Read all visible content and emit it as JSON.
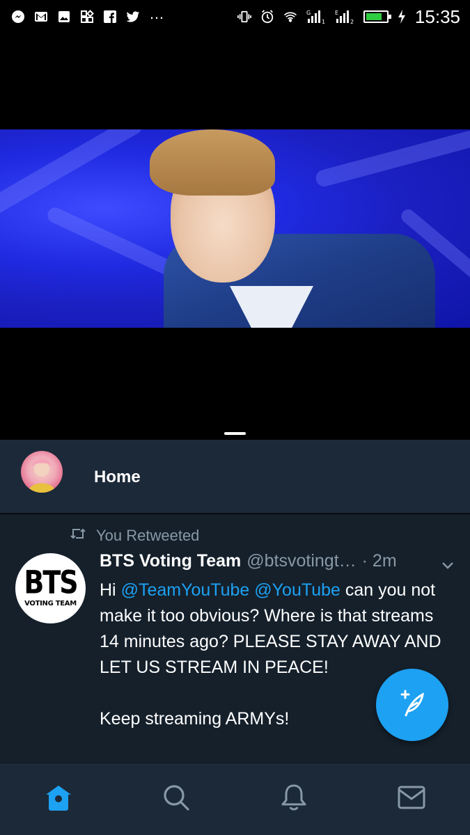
{
  "status_bar": {
    "time": "15:35",
    "left_icons": [
      "messenger-icon",
      "gmail-icon",
      "gallery-icon",
      "apps-icon",
      "facebook-icon",
      "twitter-icon"
    ],
    "more": "…",
    "right_icons": [
      "vibrate-icon",
      "alarm-icon",
      "wifi-icon",
      "signal-sim1-icon",
      "signal-sim2-icon",
      "battery-icon",
      "charging-icon"
    ],
    "battery_level": 0.8
  },
  "header": {
    "title": "Home"
  },
  "tweet": {
    "retweet_label": "You Retweeted",
    "author_name": "BTS Voting Team",
    "author_handle": "@btsvotingt…",
    "time": "· 2m",
    "avatar_text_big": "BTS",
    "avatar_text_small": "VOTING TEAM",
    "body_pre": "Hi ",
    "mention_1": "@TeamYouTube",
    "mention_2": "@YouTube",
    "body_post": " can you not make it too obvious? Where is that streams 14 minutes ago? PLEASE STAY AWAY AND LET US STREAM IN PEACE!\n\nKeep streaming ARMYs!"
  },
  "tabs": [
    {
      "name": "home",
      "icon": "home-icon",
      "active": true
    },
    {
      "name": "search",
      "icon": "search-icon",
      "active": false
    },
    {
      "name": "notifications",
      "icon": "bell-icon",
      "active": false
    },
    {
      "name": "messages",
      "icon": "mail-icon",
      "active": false
    }
  ],
  "colors": {
    "accent": "#1da1f2",
    "background": "#15202b",
    "header": "#1c2938",
    "muted": "#8899a6"
  }
}
